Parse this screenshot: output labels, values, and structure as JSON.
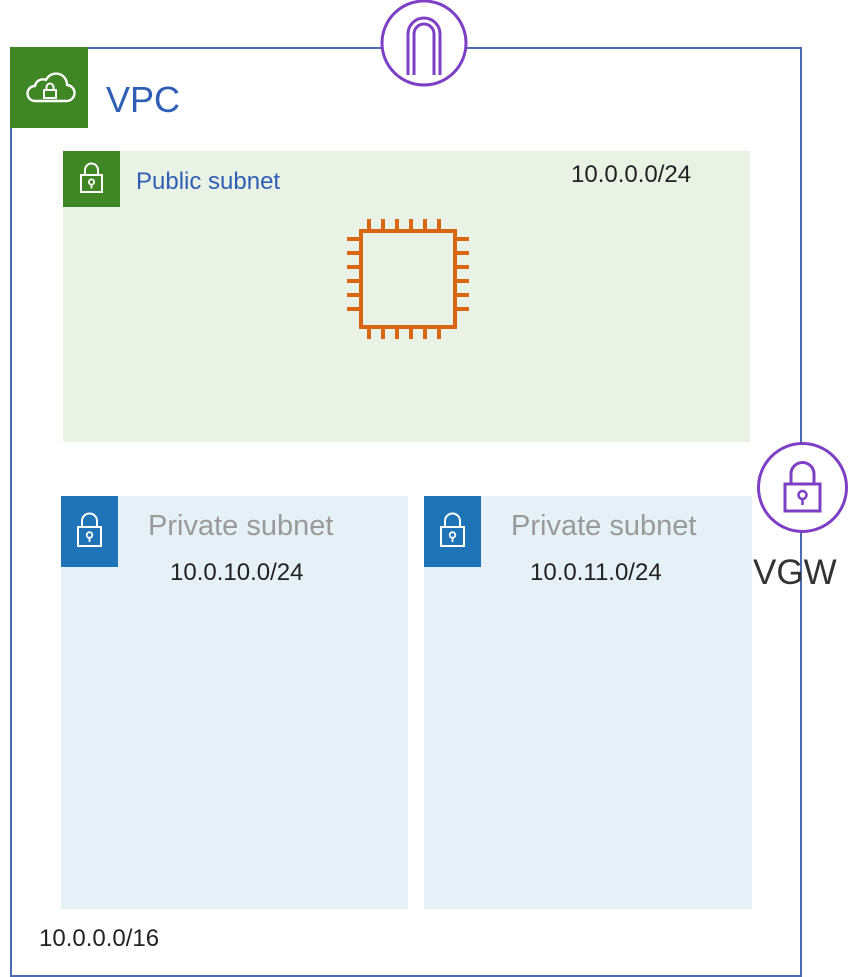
{
  "vpc": {
    "title": "VPC",
    "cidr": "10.0.0.0/16",
    "icon": "cloud-lock-icon",
    "badge_color": "#3f8624",
    "border_color": "#4a6bb0"
  },
  "internet_gateway": {
    "icon": "internet-gateway-icon",
    "color": "#7d3fc4"
  },
  "public_subnet": {
    "label": "Public subnet",
    "cidr": "10.0.0.0/24",
    "icon": "lock-icon",
    "background": "#e9f2e5",
    "instance_icon": "ec2-instance-icon",
    "instance_color": "#d86613"
  },
  "private_subnets": [
    {
      "label": "Private subnet",
      "cidr": "10.0.10.0/24",
      "icon": "lock-icon"
    },
    {
      "label": "Private subnet",
      "cidr": "10.0.11.0/24",
      "icon": "lock-icon"
    }
  ],
  "private_subnet_style": {
    "background": "#e6f0f7",
    "badge_color": "#1f73b7"
  },
  "vgw": {
    "label": "VGW",
    "icon": "vpn-gateway-icon",
    "color": "#7d3fc4"
  }
}
